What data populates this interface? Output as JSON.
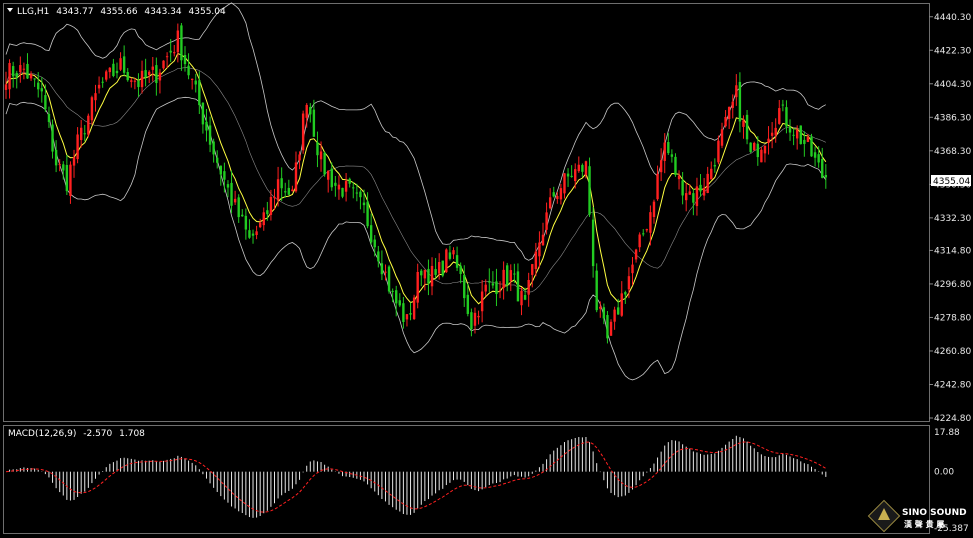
{
  "chart_data": [
    {
      "type": "candlestick",
      "header": {
        "symbol": "LLG,H1",
        "open": "4343.77",
        "high": "4355.66",
        "low": "4343.34",
        "close": "4355.04"
      },
      "ylim": [
        4224.8,
        4445
      ],
      "y_ticks": [
        "4440.30",
        "4422.30",
        "4404.30",
        "4386.30",
        "4368.30",
        "4350.30",
        "4332.30",
        "4314.80",
        "4296.80",
        "4278.80",
        "4260.80",
        "4242.80",
        "4224.80"
      ],
      "last_price": "4355.04",
      "indicators": [
        "Bollinger Bands",
        "Moving Average"
      ],
      "colors": {
        "up": "#ff2020",
        "down": "#22cc22",
        "bands": "#c8c8c8",
        "ma": "#ffff40",
        "background": "#000000",
        "grid_border": "#6e6e6e"
      },
      "close_path": [
        {
          "i": 0,
          "v": 4410
        },
        {
          "i": 5,
          "v": 4412
        },
        {
          "i": 10,
          "v": 4398
        },
        {
          "i": 14,
          "v": 4362
        },
        {
          "i": 17,
          "v": 4352
        },
        {
          "i": 20,
          "v": 4372
        },
        {
          "i": 26,
          "v": 4402
        },
        {
          "i": 32,
          "v": 4414
        },
        {
          "i": 37,
          "v": 4405
        },
        {
          "i": 42,
          "v": 4410
        },
        {
          "i": 48,
          "v": 4428
        },
        {
          "i": 52,
          "v": 4405
        },
        {
          "i": 58,
          "v": 4368
        },
        {
          "i": 63,
          "v": 4342
        },
        {
          "i": 68,
          "v": 4320
        },
        {
          "i": 72,
          "v": 4330
        },
        {
          "i": 76,
          "v": 4352
        },
        {
          "i": 80,
          "v": 4344
        },
        {
          "i": 84,
          "v": 4398
        },
        {
          "i": 88,
          "v": 4362
        },
        {
          "i": 92,
          "v": 4350
        },
        {
          "i": 96,
          "v": 4346
        },
        {
          "i": 100,
          "v": 4336
        },
        {
          "i": 104,
          "v": 4314
        },
        {
          "i": 108,
          "v": 4290
        },
        {
          "i": 112,
          "v": 4276
        },
        {
          "i": 116,
          "v": 4306
        },
        {
          "i": 120,
          "v": 4300
        },
        {
          "i": 124,
          "v": 4314
        },
        {
          "i": 127,
          "v": 4300
        },
        {
          "i": 130,
          "v": 4276
        },
        {
          "i": 134,
          "v": 4294
        },
        {
          "i": 138,
          "v": 4298
        },
        {
          "i": 141,
          "v": 4302
        },
        {
          "i": 145,
          "v": 4284
        },
        {
          "i": 149,
          "v": 4320
        },
        {
          "i": 153,
          "v": 4345
        },
        {
          "i": 158,
          "v": 4356
        },
        {
          "i": 162,
          "v": 4360
        },
        {
          "i": 165,
          "v": 4285
        },
        {
          "i": 168,
          "v": 4266
        },
        {
          "i": 172,
          "v": 4290
        },
        {
          "i": 176,
          "v": 4312
        },
        {
          "i": 180,
          "v": 4336
        },
        {
          "i": 184,
          "v": 4372
        },
        {
          "i": 188,
          "v": 4352
        },
        {
          "i": 192,
          "v": 4344
        },
        {
          "i": 196,
          "v": 4354
        },
        {
          "i": 200,
          "v": 4376
        },
        {
          "i": 204,
          "v": 4398
        },
        {
          "i": 208,
          "v": 4365
        },
        {
          "i": 212,
          "v": 4376
        },
        {
          "i": 216,
          "v": 4390
        },
        {
          "i": 220,
          "v": 4380
        },
        {
          "i": 224,
          "v": 4370
        },
        {
          "i": 228,
          "v": 4355
        },
        {
          "i": 229,
          "v": 4355
        }
      ],
      "bars": 230
    },
    {
      "type": "histogram",
      "header": {
        "label": "MACD(12,26,9)",
        "main": "-2.570",
        "signal": "1.708"
      },
      "y_ticks": [
        "17.88",
        "0.00",
        "-25.387"
      ],
      "ylim": [
        -25.387,
        17.88
      ],
      "colors": {
        "histogram": "#e8e8e8",
        "signal": "#ff2020"
      }
    }
  ],
  "logo": {
    "name": "SINO SOUND",
    "subtitle": "漢 聲 貴 屬"
  }
}
